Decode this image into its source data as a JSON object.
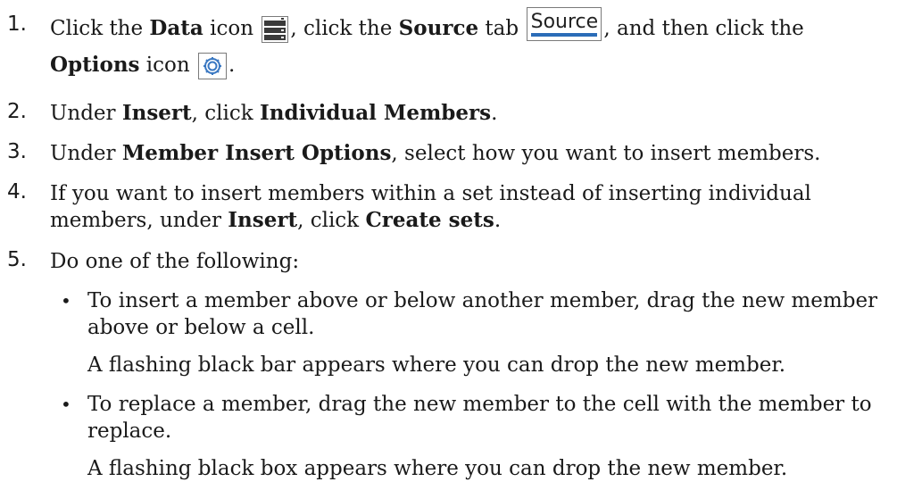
{
  "steps": [
    {
      "num": "1.",
      "line1": {
        "t1": "Click the ",
        "b1": "Data",
        "t2": " icon ",
        "t3": ", click the ",
        "b2": "Source",
        "t4": " tab ",
        "t5": ", and then click the"
      },
      "line2": {
        "b1": "Options",
        "t1": " icon ",
        "t2": "."
      },
      "source_tab_label": "Source"
    },
    {
      "num": "2.",
      "t1": "Under ",
      "b1": "Insert",
      "t2": ", click ",
      "b2": "Individual Members",
      "t3": "."
    },
    {
      "num": "3.",
      "t1": "Under ",
      "b1": "Member Insert Options",
      "t2": ", select how you want to insert members."
    },
    {
      "num": "4.",
      "line1": "If you want to insert members within a set instead of inserting individual",
      "line2": {
        "t1": "members, under ",
        "b1": "Insert",
        "t2": ", click ",
        "b2": "Create sets",
        "t3": "."
      }
    },
    {
      "num": "5.",
      "text": "Do one of the following:",
      "bullets": [
        {
          "line1": "To insert a member above or below another member, drag the new member",
          "line2": "above or below a cell.",
          "result": "A flashing black bar appears where you can drop the new member."
        },
        {
          "line1": "To replace a member, drag the new member to the cell with the member to",
          "line2": "replace.",
          "result": "A flashing black box appears where you can drop the new member."
        }
      ]
    }
  ],
  "bullet_char": "•",
  "colors": {
    "text": "#1a1a1a",
    "tab_underline": "#2b6cb8",
    "options_icon": "#3a78c2"
  }
}
